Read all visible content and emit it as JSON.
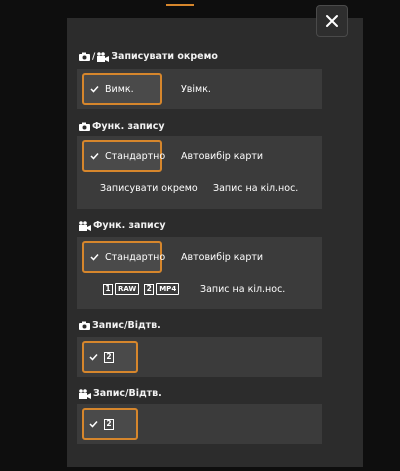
{
  "colors": {
    "accent": "#d6862c",
    "dialog_bg": "#2c2c2c",
    "panel_bg": "#3b3b3b"
  },
  "close_icon": "close-icon",
  "sections": {
    "rec_separately_both": {
      "title": "Записувати окремо",
      "icons": [
        "camera-icon",
        "video-camera-icon"
      ],
      "options": [
        "Вимк.",
        "Увімк."
      ],
      "selected": "Вимк."
    },
    "rec_function_photo": {
      "title": "Функ. запису",
      "icons": [
        "camera-icon"
      ],
      "options": [
        "Стандартно",
        "Автовибір карти",
        "Записувати окремо",
        "Запис на кіл.нос."
      ],
      "selected": "Стандартно"
    },
    "rec_function_video": {
      "title": "Функ. запису",
      "icons": [
        "video-camera-icon"
      ],
      "options": [
        "Стандартно",
        "Автовибір карти",
        "Запис на кіл.нос."
      ],
      "selected": "Стандартно",
      "multi_media": {
        "card1": "1",
        "format1": "RAW",
        "card2": "2",
        "format2": "MP4"
      }
    },
    "rec_play_photo": {
      "title": "Запис/Відтв.",
      "icons": [
        "camera-icon"
      ],
      "card": "2"
    },
    "rec_play_video": {
      "title": "Запис/Відтв.",
      "icons": [
        "video-camera-icon"
      ],
      "card": "2"
    }
  }
}
